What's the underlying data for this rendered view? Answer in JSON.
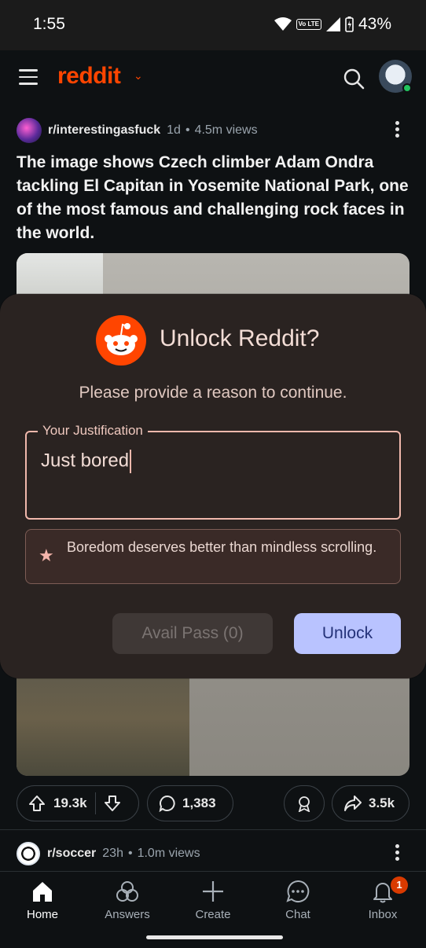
{
  "status_bar": {
    "time": "1:55",
    "battery": "43%",
    "volte_label": "Vo LTE"
  },
  "header": {
    "logo": "reddit"
  },
  "post": {
    "subreddit": "r/interestingasfuck",
    "age": "1d",
    "views": "4.5m views",
    "title": "The image shows Czech climber Adam Ondra tackling El Capitan in Yosemite National Park, one of the most famous and challenging rock faces in the world.",
    "upvotes": "19.3k",
    "comments": "1,383",
    "shares": "3.5k"
  },
  "next_post": {
    "subreddit": "r/soccer",
    "age": "23h",
    "views": "1.0m views"
  },
  "modal": {
    "title": "Unlock Reddit?",
    "subtitle": "Please provide a reason to continue.",
    "field_label": "Your Justification",
    "field_value": "Just bored",
    "hint": "Boredom deserves better than mindless scrolling.",
    "pass_button": "Avail Pass (0)",
    "unlock_button": "Unlock"
  },
  "nav": {
    "items": [
      {
        "label": "Home",
        "icon": "home-icon"
      },
      {
        "label": "Answers",
        "icon": "answers-icon"
      },
      {
        "label": "Create",
        "icon": "plus-icon"
      },
      {
        "label": "Chat",
        "icon": "chat-icon"
      },
      {
        "label": "Inbox",
        "icon": "bell-icon"
      }
    ],
    "inbox_badge": "1"
  },
  "colors": {
    "accent": "#ff4500",
    "unlock_button": "#b9c3ff",
    "modal_bg": "#2a2321"
  }
}
